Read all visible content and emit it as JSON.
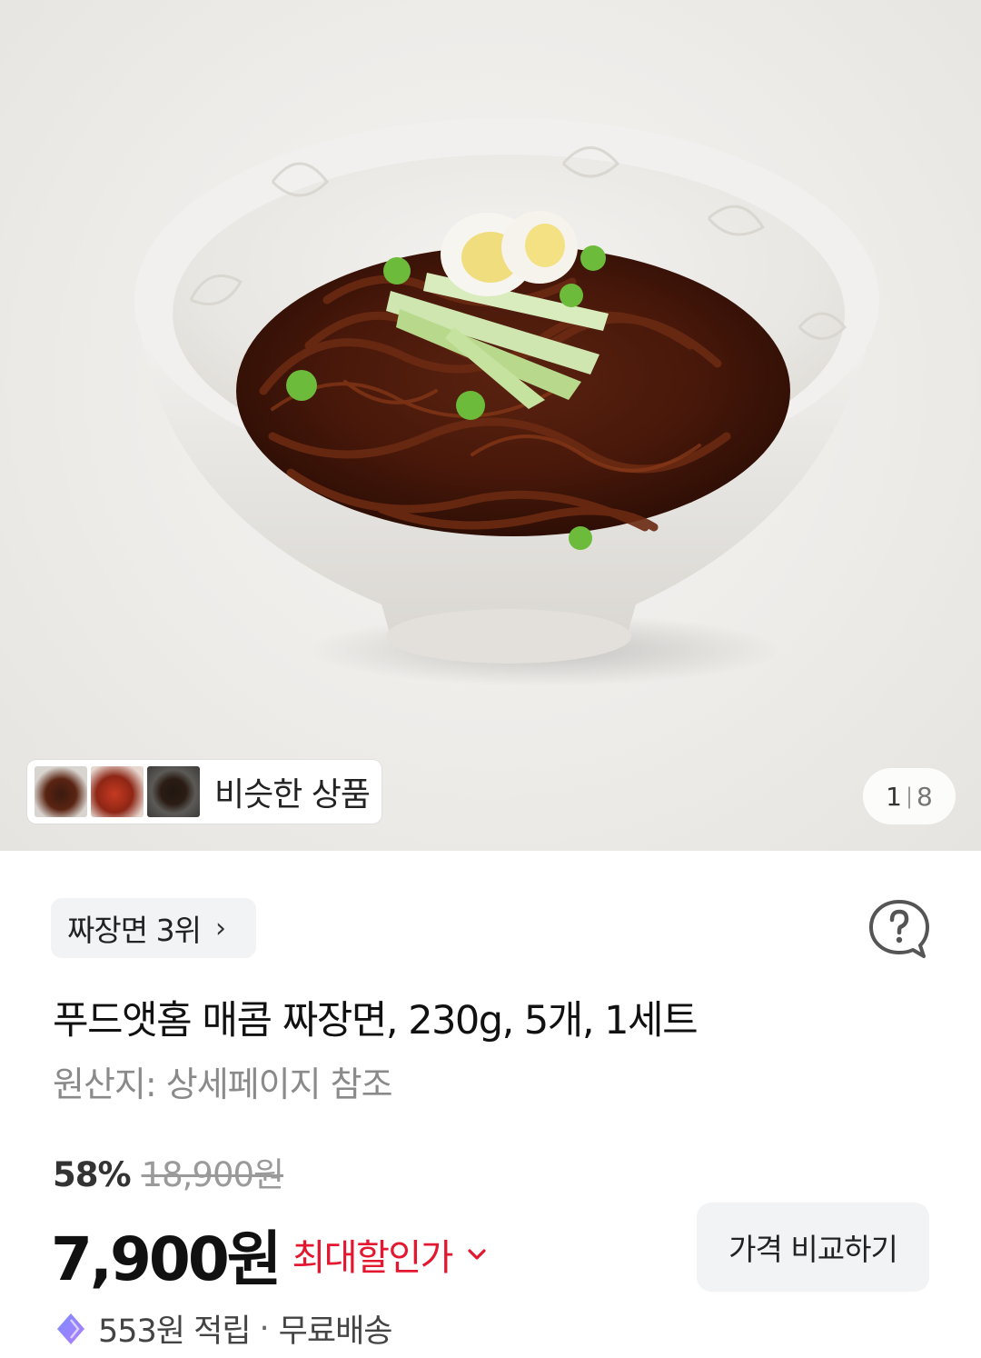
{
  "gallery": {
    "similar_label": "비슷한 상품",
    "current_page": "1",
    "page_separator": "|",
    "total_pages": "8"
  },
  "product": {
    "rank_label": "짜장면 3위",
    "rank_chevron": "›",
    "title": "푸드앳홈 매콤 짜장면, 230g, 5개, 1세트",
    "origin": "원산지: 상세페이지 참조"
  },
  "pricing": {
    "discount_percent": "58%",
    "original_price": "18,900원",
    "sale_price": "7,900원",
    "best_price_label": "최대할인가",
    "compare_button": "가격 비교하기",
    "accent_color": "#e3172f"
  },
  "benefits": {
    "reward_text": "553원 적립",
    "separator": "·",
    "shipping_text": "무료배송"
  },
  "icons": {
    "help": "question-bubble-icon",
    "reward": "cash-badge-icon",
    "dropdown": "chevron-down-icon"
  }
}
